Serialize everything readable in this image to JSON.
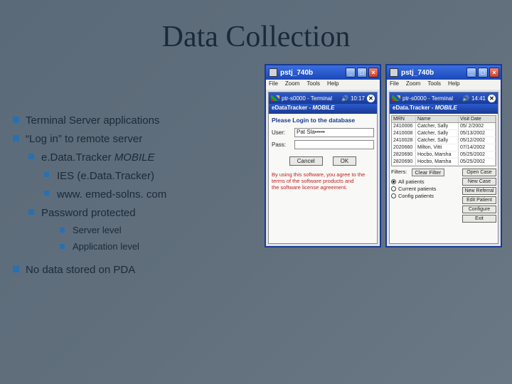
{
  "title": "Data Collection",
  "bullets": {
    "b1": "Terminal Server applications",
    "b2": "“Log in” to remote server",
    "b2a_pre": "e.Data.Tracker ",
    "b2a_em": "MOBILE",
    "b2a1": "IES (e.Data.Tracker)",
    "b2a2": "www. emed-solns. com",
    "b2b": "Password protected",
    "b2b1": "Server level",
    "b2b2": "Application level",
    "b3": "No data stored on PDA"
  },
  "win1": {
    "title": "pstj_740b",
    "menus": [
      "File",
      "Zoom",
      "Tools",
      "Help"
    ],
    "pda_title": "ptr-s0000 - Terminal",
    "time": "10:17",
    "appbar_a": "eDataTracker",
    "appbar_sep": " - ",
    "appbar_b": "MOBILE",
    "login_msg": "Please Login to the database",
    "user_lbl": "User:",
    "user_val": "Pat Sla•••••",
    "pass_lbl": "Pass:",
    "cancel": "Cancel",
    "ok": "OK",
    "legal1": "By using this software, you agree to the",
    "legal2": "terms of the software products and",
    "legal3": "the software license agreement."
  },
  "win2": {
    "title": "pstj_740b",
    "menus": [
      "File",
      "Zoom",
      "Tools",
      "Help"
    ],
    "pda_title": "ptr-s0000 - Terminal",
    "time": "14:41",
    "appbar_a": "eData.Tracker",
    "appbar_sep": " - ",
    "appbar_b": "MOBILE",
    "cols": [
      "MRN",
      "Name",
      "Visit Date"
    ],
    "rows": [
      [
        "2410006",
        "Catcher, Sally",
        "05/ 2/2002"
      ],
      [
        "2410008",
        "Catcher, Sally",
        "05/13/2002"
      ],
      [
        "2410028",
        "Catcher, Sally",
        "05/12/2002"
      ],
      [
        "2020660",
        "Milton, Vitti",
        "07/14/2002"
      ],
      [
        "2820690",
        "Hocbo, Marsha",
        "05/25/2002"
      ],
      [
        "2820690",
        "Hocbo, Marsha",
        "05/25/2002"
      ]
    ],
    "filters_lbl": "Filters:",
    "clear": "Clear Filter",
    "r1": "All patients",
    "r2": "Current patients",
    "r3": "Config patients",
    "btns": [
      "Open Case",
      "New Case",
      "New Referral",
      "Edit Patient",
      "Configure",
      "Exit"
    ]
  }
}
